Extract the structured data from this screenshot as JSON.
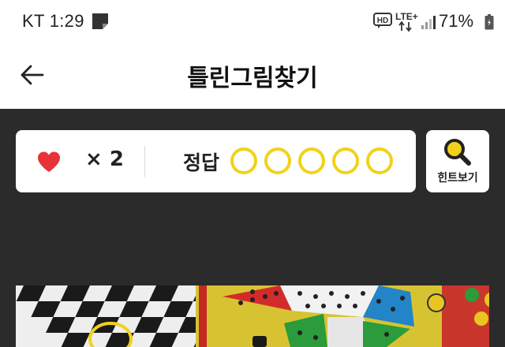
{
  "status_bar": {
    "carrier_time": "KT 1:29",
    "network": "LTE+",
    "hd": "HD",
    "battery": "71%"
  },
  "header": {
    "title": "틀린그림찾기",
    "back_icon": "arrow-left-icon"
  },
  "game": {
    "lives_label": "× 2",
    "lives": 2,
    "answer_label": "정답",
    "answers_found": 0,
    "answers_total": 5,
    "hint_label": "힌트보기",
    "hint_icon": "magnifier-icon"
  },
  "colors": {
    "accent_yellow": "#f1d21a",
    "heart_red": "#e8323a",
    "background_dark": "#2b2b2b"
  }
}
